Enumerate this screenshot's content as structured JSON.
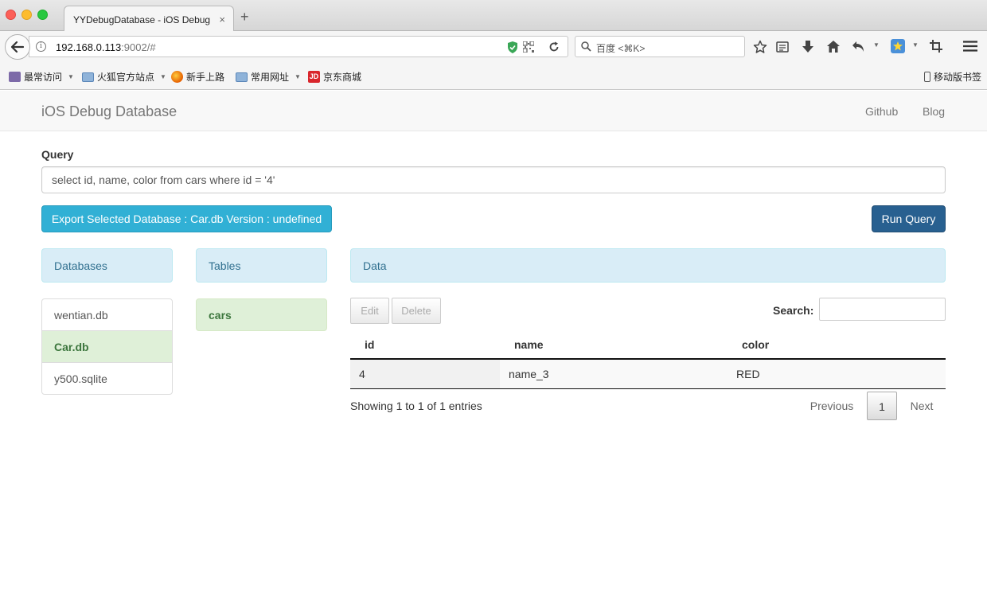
{
  "browser": {
    "tab_title": "YYDebugDatabase - iOS Debug D",
    "tab_close": "×",
    "new_tab": "+",
    "url_host": "192.168.0.113",
    "url_rest": ":9002/#",
    "search_placeholder": "百度 <⌘K>",
    "bookmarks": [
      {
        "label": "最常访问",
        "icon": "most-visited-icon",
        "has_menu": true
      },
      {
        "label": "火狐官方站点",
        "icon": "folder-icon",
        "has_menu": true
      },
      {
        "label": "新手上路",
        "icon": "firefox-icon",
        "has_menu": false
      },
      {
        "label": "常用网址",
        "icon": "folder-icon",
        "has_menu": true
      },
      {
        "label": "京东商城",
        "icon": "jd-icon",
        "has_menu": false
      }
    ],
    "jd_icon_text": "JD",
    "mobile_bookmarks": "移动版书签"
  },
  "app": {
    "brand": "iOS Debug Database",
    "nav": [
      "Github",
      "Blog"
    ]
  },
  "query": {
    "label": "Query",
    "value": "select id, name, color from cars where id = '4'"
  },
  "buttons": {
    "export": "Export Selected Database : Car.db Version : undefined",
    "run": "Run Query"
  },
  "panels": {
    "databases": "Databases",
    "tables": "Tables",
    "data": "Data"
  },
  "databases": [
    {
      "name": "wentian.db",
      "active": false
    },
    {
      "name": "Car.db",
      "active": true
    },
    {
      "name": "y500.sqlite",
      "active": false
    }
  ],
  "tables": [
    {
      "name": "cars",
      "active": true
    }
  ],
  "datatable": {
    "edit": "Edit",
    "delete": "Delete",
    "search_label": "Search:",
    "search_value": "",
    "columns": [
      "id",
      "name",
      "color"
    ],
    "rows": [
      [
        "4",
        "name_3",
        "RED"
      ]
    ],
    "info": "Showing 1 to 1 of 1 entries",
    "previous": "Previous",
    "page": "1",
    "next": "Next"
  },
  "colors": {
    "info_button": "#31b0d5",
    "primary_button": "#286090",
    "panel_info": "#d9edf7",
    "active_item": "#dff0d8"
  }
}
